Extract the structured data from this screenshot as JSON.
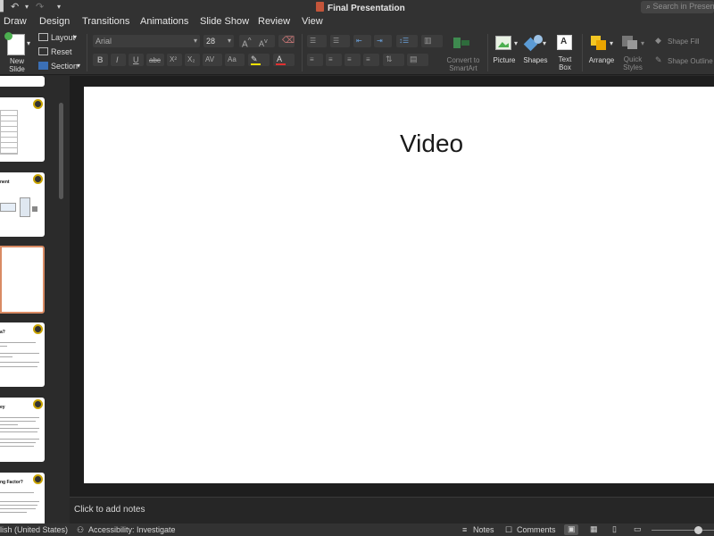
{
  "window": {
    "title": "Final Presentation"
  },
  "quick_access": {
    "undo": "↶",
    "redo": "↷",
    "more": "▾"
  },
  "search": {
    "placeholder": "Search in Presentation"
  },
  "tabs": [
    "Draw",
    "Design",
    "Transitions",
    "Animations",
    "Slide Show",
    "Review",
    "View"
  ],
  "ribbon": {
    "new_slide": "New\nSlide",
    "layout": "Layout",
    "reset": "Reset",
    "section": "Section",
    "font_name": "Arial",
    "font_size": "28",
    "bold": "B",
    "italic": "I",
    "underline": "U",
    "strikethrough": "abc",
    "superscript": "X²",
    "subscript": "X₂",
    "char_spacing": "AV",
    "change_case": "Aa",
    "convert_smartart": "Convert to\nSmartArt",
    "picture": "Picture",
    "shapes": "Shapes",
    "text_box": "Text\nBox",
    "arrange": "Arrange",
    "quick_styles": "Quick\nStyles",
    "shape_fill": "Shape Fill",
    "shape_outline": "Shape Outline"
  },
  "thumbnails": [
    {
      "title": ""
    },
    {
      "title": ""
    },
    {
      "title": "nent"
    },
    {
      "title": ""
    },
    {
      "title": "a?"
    },
    {
      "title": "ey"
    },
    {
      "title": "ng Factor?"
    }
  ],
  "slide": {
    "title": "Video"
  },
  "notes": {
    "placeholder": "Click to add notes"
  },
  "status": {
    "language": "lish (United States)",
    "accessibility": "Accessibility: Investigate",
    "notes": "Notes",
    "comments": "Comments"
  },
  "colors": {
    "accent": "#d98b64",
    "ribbon_bg": "#323232",
    "slide_bg": "#ffffff"
  }
}
